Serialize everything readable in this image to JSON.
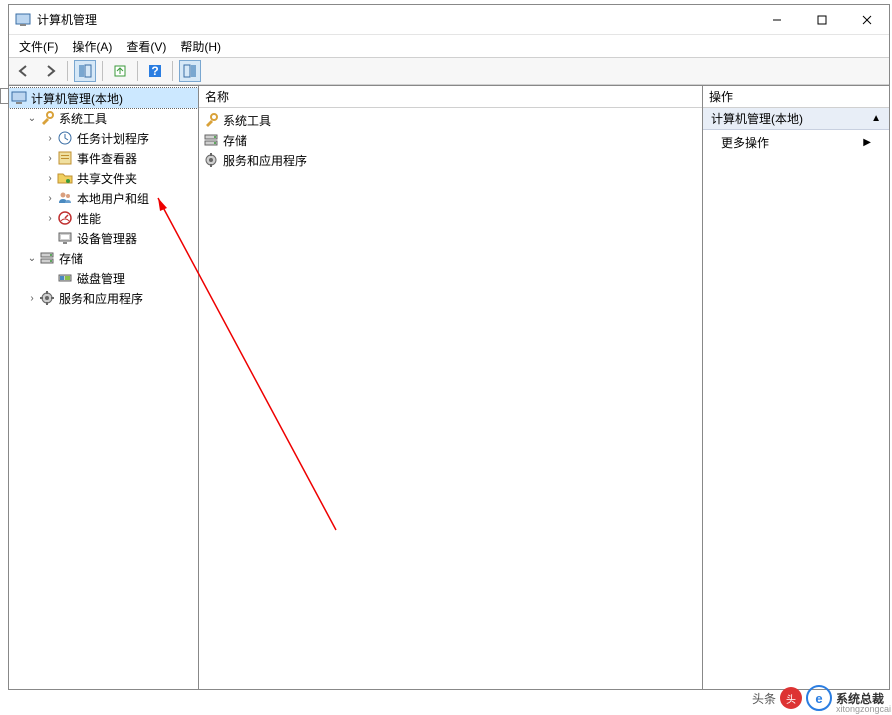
{
  "window": {
    "title": "计算机管理"
  },
  "menu": {
    "file": "文件(F)",
    "action": "操作(A)",
    "view": "查看(V)",
    "help": "帮助(H)"
  },
  "tree": {
    "root": "计算机管理(本地)",
    "system_tools": "系统工具",
    "task_scheduler": "任务计划程序",
    "event_viewer": "事件查看器",
    "shared_folders": "共享文件夹",
    "local_users": "本地用户和组",
    "performance": "性能",
    "device_manager": "设备管理器",
    "storage": "存储",
    "disk_management": "磁盘管理",
    "services_apps": "服务和应用程序"
  },
  "list": {
    "header": "名称",
    "item1": "系统工具",
    "item2": "存储",
    "item3": "服务和应用程序"
  },
  "actions": {
    "header": "操作",
    "group": "计算机管理(本地)",
    "more": "更多操作"
  },
  "watermark": {
    "text1": "头条",
    "text2": "系统总裁",
    "sub": "xitongzongcai"
  }
}
